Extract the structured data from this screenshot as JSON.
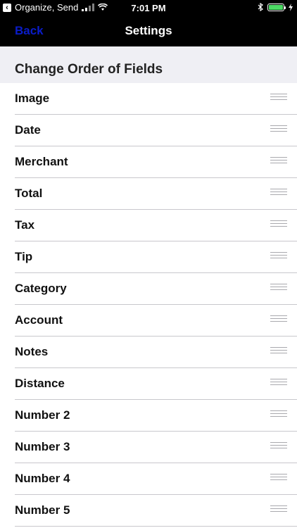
{
  "status_bar": {
    "back_app_label": "Organize, Send",
    "time": "7:01 PM"
  },
  "nav": {
    "back_label": "Back",
    "title": "Settings"
  },
  "section": {
    "title": "Change Order of Fields"
  },
  "fields": [
    {
      "label": "Image"
    },
    {
      "label": "Date"
    },
    {
      "label": "Merchant"
    },
    {
      "label": "Total"
    },
    {
      "label": "Tax"
    },
    {
      "label": "Tip"
    },
    {
      "label": "Category"
    },
    {
      "label": "Account"
    },
    {
      "label": "Notes"
    },
    {
      "label": "Distance"
    },
    {
      "label": "Number 2"
    },
    {
      "label": "Number 3"
    },
    {
      "label": "Number 4"
    },
    {
      "label": "Number 5"
    }
  ],
  "colors": {
    "back_link": "#0a1cc9",
    "battery": "#4cd964",
    "section_bg": "#efeff4"
  },
  "icons": {
    "reorder": "reorder-grip-icon",
    "battery": "battery-icon",
    "wifi": "wifi-icon",
    "bluetooth": "bluetooth-icon"
  }
}
